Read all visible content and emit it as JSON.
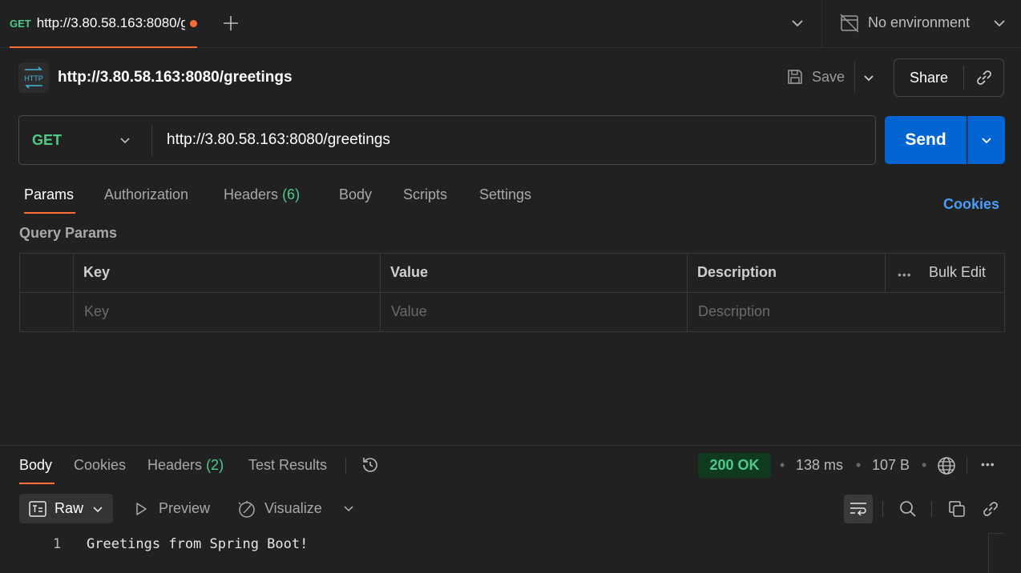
{
  "tab": {
    "method": "GET",
    "title": "http://3.80.58.163:8080/greetings",
    "unsaved": true
  },
  "environment": {
    "label": "No environment"
  },
  "header": {
    "badge": "HTTP",
    "name": "http://3.80.58.163:8080/greetings",
    "save_label": "Save",
    "share_label": "Share"
  },
  "request": {
    "method": "GET",
    "url": "http://3.80.58.163:8080/greetings",
    "send_label": "Send"
  },
  "request_tabs": [
    {
      "label": "Params",
      "active": true
    },
    {
      "label": "Authorization"
    },
    {
      "label": "Headers",
      "count": "(6)"
    },
    {
      "label": "Body"
    },
    {
      "label": "Scripts"
    },
    {
      "label": "Settings"
    }
  ],
  "cookies_link": "Cookies",
  "query_params": {
    "title": "Query Params",
    "columns": [
      "Key",
      "Value",
      "Description"
    ],
    "bulk_edit": "Bulk Edit",
    "placeholders": [
      "Key",
      "Value",
      "Description"
    ]
  },
  "response_tabs": [
    {
      "label": "Body",
      "active": true
    },
    {
      "label": "Cookies"
    },
    {
      "label": "Headers",
      "count": "(2)"
    },
    {
      "label": "Test Results"
    }
  ],
  "response_meta": {
    "status": "200 OK",
    "time": "138 ms",
    "size": "107 B"
  },
  "response_toolbar": {
    "format": "Raw",
    "preview": "Preview",
    "visualize": "Visualize"
  },
  "response_body": {
    "line_number": "1",
    "text": "Greetings from Spring Boot!"
  },
  "colors": {
    "accent": "#ff6c37",
    "method_get": "#4ec98a",
    "send": "#0265d2",
    "link": "#4a9df8"
  }
}
